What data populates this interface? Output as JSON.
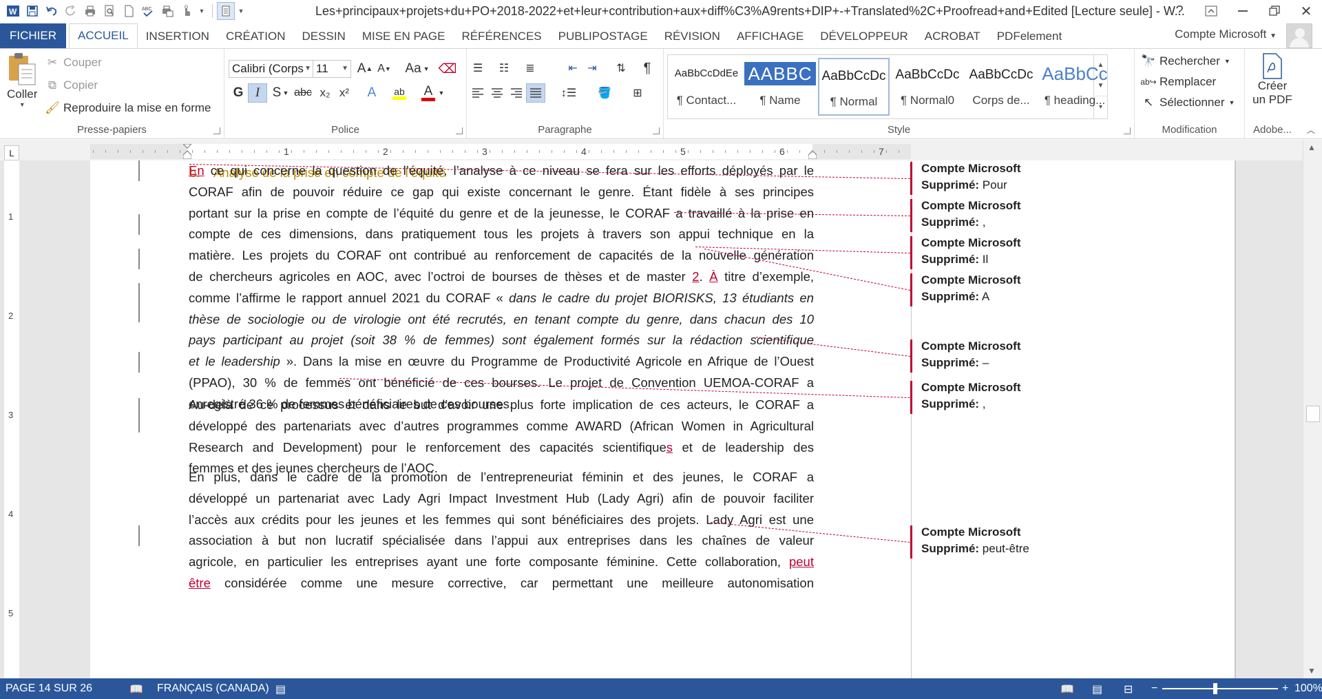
{
  "window": {
    "title": "Les+principaux+projets+du+PO+2018-2022+et+leur+contribution+aux+diff%C3%A9rents+DIP+-+Translated%2C+Proofread+and+Edited [Lecture seule] - W...",
    "help": "?",
    "icons": [
      "word-logo-icon",
      "save-icon",
      "undo-icon",
      "redo-icon",
      "print-icon",
      "print-preview-icon",
      "new-document-icon",
      "spelling-icon",
      "quick-print-icon",
      "touch-mode-icon",
      "layout-icon"
    ]
  },
  "tabs": [
    "FICHIER",
    "ACCUEIL",
    "INSERTION",
    "CRÉATION",
    "DESSIN",
    "MISE EN PAGE",
    "RÉFÉRENCES",
    "PUBLIPOSTAGE",
    "RÉVISION",
    "AFFICHAGE",
    "DÉVELOPPEUR",
    "ACROBAT",
    "PDFelement"
  ],
  "active_tab": "ACCUEIL",
  "account": "Compte Microsoft",
  "ribbon": {
    "clipboard": {
      "label": "Presse-papiers",
      "paste": "Coller",
      "cut": "Couper",
      "copy": "Copier",
      "format_painter": "Reproduire la mise en forme"
    },
    "font": {
      "label": "Police",
      "font_name": "Calibri (Corps",
      "font_size": "11",
      "bold": "G",
      "italic": "I",
      "underline": "S",
      "strike": "abc",
      "subscript": "x₂",
      "superscript": "x²",
      "grow": "A",
      "shrink": "A",
      "case": "Aa",
      "effects": "A",
      "highlight": "ab",
      "font_color": "A"
    },
    "paragraph": {
      "label": "Paragraphe"
    },
    "styles": {
      "label": "Style",
      "items": [
        {
          "sample": "AaBbCcDdEe",
          "name": "¶ Contact..."
        },
        {
          "sample": "AABBC",
          "name": "¶ Name"
        },
        {
          "sample": "AaBbCcDc",
          "name": "¶ Normal"
        },
        {
          "sample": "AaBbCcDc",
          "name": "¶ Normal0"
        },
        {
          "sample": "AaBbCcDc",
          "name": "Corps de..."
        },
        {
          "sample": "AaBbCc",
          "name": "¶ heading..."
        }
      ]
    },
    "editing": {
      "label": "Modification",
      "find": "Rechercher",
      "replace": "Remplacer",
      "select": "Sélectionner"
    },
    "adobe": {
      "label": "Adobe...",
      "create_pdf_line1": "Créer",
      "create_pdf_line2": "un PDF"
    }
  },
  "ruler": {
    "numbers": [
      "1",
      "2",
      "3",
      "4",
      "5",
      "6",
      "7"
    ],
    "vertical_numbers": [
      "1",
      "2",
      "3",
      "4",
      "5"
    ],
    "tab_selector": "L"
  },
  "document": {
    "heading": "b.    Analyse de la prise en compte de l’équité",
    "paragraphs": [
      {
        "lines": [
          [
            {
              "t": "En",
              "ins": true
            },
            {
              "t": " ce qui concerne la question de l’équité, l’analyse à ce niveau se fera sur les efforts déployés par le"
            }
          ],
          [
            {
              "t": "CORAF afin de pouvoir réduire ce gap qui existe concernant le genre. Étant fidèle à ses principes"
            }
          ],
          [
            {
              "t": "portant sur la prise en compte de l’équité du genre et de la jeunesse, le CORAF a travaillé à la prise en"
            }
          ],
          [
            {
              "t": "compte de ces dimensions, dans pratiquement tous les projets à travers son appui technique en la"
            }
          ],
          [
            {
              "t": "matière. Les projets du CORAF ont contribué au renforcement de capacités de la nouvelle génération"
            }
          ],
          [
            {
              "t": "de chercheurs agricoles en AOC, avec l’octroi de bourses de thèses et de master "
            },
            {
              "t": "2",
              "ins": true
            },
            {
              "t": ". "
            },
            {
              "t": "À",
              "ins": true
            },
            {
              "t": " titre d’exemple,"
            }
          ],
          [
            {
              "t": "comme l’affirme le rapport annuel 2021 du CORAF « "
            },
            {
              "t": "dans le cadre du projet BIORISKS, 13 étudiants en",
              "em": true
            }
          ],
          [
            {
              "t": "thèse de sociologie ou de virologie ont été recrutés, en tenant compte du genre, dans chacun des 10",
              "em": true
            }
          ],
          [
            {
              "t": "pays participant au projet (soit 38 % de femmes) sont également formés sur la rédaction scientifique",
              "em": true
            }
          ],
          [
            {
              "t": "et le leadership",
              "em": true
            },
            {
              "t": " ». Dans la mise en œuvre du Programme de Productivité Agricole en Afrique de l’Ouest"
            }
          ],
          [
            {
              "t": "(PPAO), 30 % de femmes ont bénéficié de ces bourses. Le projet de Convention UEMOA-CORAF a"
            }
          ],
          [
            {
              "t": "enregistré 36 % de femmes bénéficiaires de ces bourses."
            }
          ]
        ]
      },
      {
        "lines": [
          [
            {
              "t": "Au-delà de ce processus et dans le but d’avoir une plus forte implication de ces acteurs, le CORAF a"
            }
          ],
          [
            {
              "t": "développé des partenariats avec d’autres programmes comme AWARD (African Women in Agricultural"
            }
          ],
          [
            {
              "t": "Research and Development) pour le renforcement des capacités scientifique"
            },
            {
              "t": "s",
              "ins": true
            },
            {
              "t": " et de leadership des"
            }
          ],
          [
            {
              "t": "femmes et des jeunes chercheurs de l’AOC."
            }
          ]
        ]
      },
      {
        "lines": [
          [
            {
              "t": "En plus, dans le cadre de la promotion de l’entrepreneuriat féminin et des jeunes, le CORAF a"
            }
          ],
          [
            {
              "t": "développé un partenariat avec Lady Agri Impact Investment Hub (Lady Agri) afin de pouvoir faciliter"
            }
          ],
          [
            {
              "t": "l’accès aux crédits pour les jeunes et les femmes qui sont bénéficiaires des projets. Lady Agri est une"
            }
          ],
          [
            {
              "t": "association à but non lucratif spécialisée dans l’appui aux entreprises dans les chaînes de valeur"
            }
          ],
          [
            {
              "t": "agricole, en particulier les entreprises ayant une forte composante féminine. Cette collaboration, "
            },
            {
              "t": "peut",
              "ins": true
            }
          ],
          [
            {
              "t": "être",
              "ins": true
            },
            {
              "t": " considérée comme une mesure corrective, car permettant une meilleure autonomisation"
            }
          ]
        ]
      }
    ]
  },
  "comments": [
    {
      "author": "Compte Microsoft",
      "label": "Supprimé:",
      "text": "Pour"
    },
    {
      "author": "Compte Microsoft",
      "label": "Supprimé:",
      "text": ","
    },
    {
      "author": "Compte Microsoft",
      "label": "Supprimé:",
      "text": "Il"
    },
    {
      "author": "Compte Microsoft",
      "label": "Supprimé:",
      "text": "A"
    },
    {
      "author": "Compte Microsoft",
      "label": "Supprimé:",
      "text": " –"
    },
    {
      "author": "Compte Microsoft",
      "label": "Supprimé:",
      "text": ","
    },
    {
      "author": "Compte Microsoft",
      "label": "Supprimé:",
      "text": "peut-être"
    }
  ],
  "statusbar": {
    "page": "PAGE 14 SUR 26",
    "language": "FRANÇAIS (CANADA)",
    "zoom": "100%",
    "zoom_minus": "−",
    "zoom_plus": "+"
  },
  "colors": {
    "accent": "#2b579a",
    "revision": "#c00030",
    "heading": "#c08a00"
  }
}
